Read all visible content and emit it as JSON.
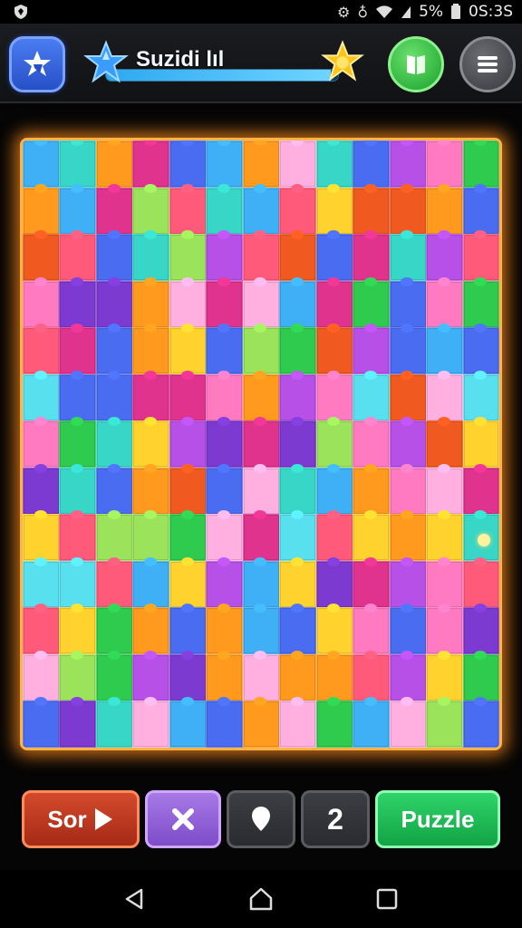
{
  "status_bar": {
    "left_icon": "shield-app-icon",
    "battery_text": "5%",
    "time": "0S:3S",
    "icons": [
      "settings-gear-icon",
      "alarm-icon",
      "wifi-icon",
      "signal-icon",
      "battery-icon"
    ]
  },
  "header": {
    "home_icon": "star-badge-icon",
    "title": "Suzidi lıl",
    "progress": 0.97,
    "star_icons": [
      "blue-star-icon",
      "gold-star-icon"
    ],
    "book_icon": "book-icon",
    "menu_icon": "hamburger-menu-icon"
  },
  "board": {
    "rows": 13,
    "cols": 13,
    "frame_color": "#ffb347",
    "palette": [
      "#ffd22e",
      "#ff9a1f",
      "#ff5a7a",
      "#e0338d",
      "#b650e6",
      "#7c3ad0",
      "#4a6cf0",
      "#3fb0f5",
      "#37d6c6",
      "#2ecb4f",
      "#9be35a",
      "#ff7ac0",
      "#58e0ee",
      "#ffb0e0",
      "#f05a20"
    ]
  },
  "controls": {
    "sort_label": "Sor",
    "sort_icon": "play-icon",
    "shuffle_icon": "close-x-icon",
    "hint_icon": "drop-icon",
    "count": "2",
    "puzzle_label": "Puzzle"
  },
  "nav": {
    "back_icon": "back-triangle-icon",
    "home_icon": "home-icon",
    "recents_icon": "recents-square-icon"
  }
}
